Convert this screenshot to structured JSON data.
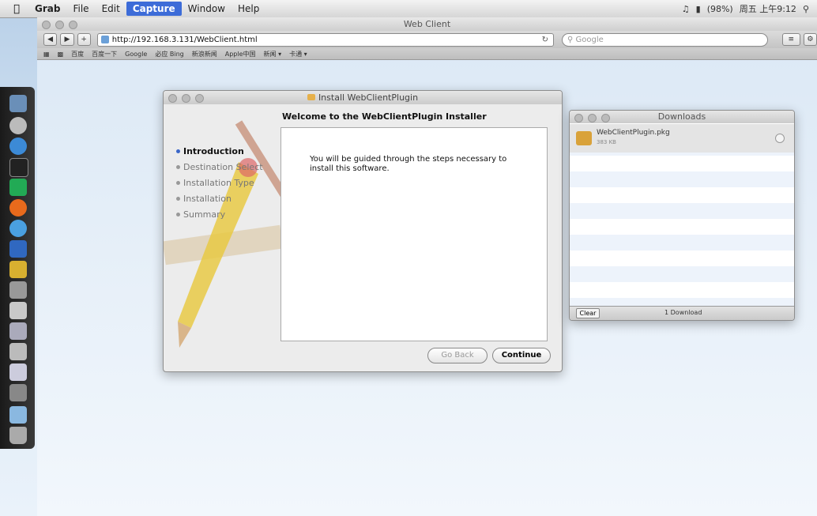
{
  "menubar": {
    "apple": "",
    "items": [
      "Grab",
      "File",
      "Edit",
      "Capture",
      "Window",
      "Help"
    ],
    "battery": "(98%)",
    "clock": "周五 上午9:12"
  },
  "browser": {
    "title": "Web Client",
    "url": "http://192.168.3.131/WebClient.html",
    "search_placeholder": "Google",
    "bookmarks": [
      "百度",
      "百度一下",
      "Google",
      "必应 Bing",
      "新浪新闻",
      "Apple中国",
      "新闻 ▾",
      "卡通 ▾"
    ]
  },
  "installer": {
    "title": "Install WebClientPlugin",
    "heading": "Welcome to the WebClientPlugin Installer",
    "steps": [
      "Introduction",
      "Destination Select",
      "Installation Type",
      "Installation",
      "Summary"
    ],
    "body": "You will be guided through the steps necessary to install this software.",
    "go_back": "Go Back",
    "continue": "Continue"
  },
  "downloads": {
    "title": "Downloads",
    "item_name": "WebClientPlugin.pkg",
    "item_size": "383 KB",
    "clear": "Clear",
    "count": "1 Download"
  }
}
